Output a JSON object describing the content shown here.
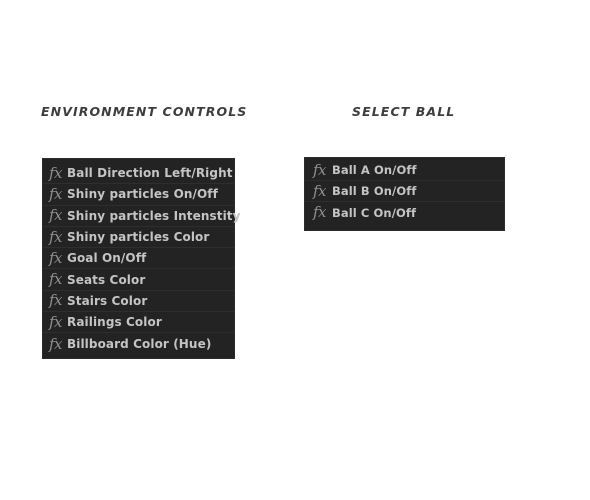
{
  "sections": {
    "environment": {
      "title": "ENVIRONMENT CONTROLS",
      "items": [
        {
          "icon": "fx-icon",
          "label": "Ball Direction Left/Right"
        },
        {
          "icon": "fx-icon",
          "label": "Shiny particles On/Off"
        },
        {
          "icon": "fx-icon",
          "label": "Shiny particles Intenstity"
        },
        {
          "icon": "fx-icon",
          "label": "Shiny particles Color"
        },
        {
          "icon": "fx-icon",
          "label": "Goal On/Off"
        },
        {
          "icon": "fx-icon",
          "label": "Seats Color"
        },
        {
          "icon": "fx-icon",
          "label": "Stairs Color"
        },
        {
          "icon": "fx-icon",
          "label": "Railings Color"
        },
        {
          "icon": "fx-icon",
          "label": "Billboard Color (Hue)"
        }
      ]
    },
    "select_ball": {
      "title": "SELECT BALL",
      "items": [
        {
          "icon": "fx-icon",
          "label": "Ball A On/Off"
        },
        {
          "icon": "fx-icon",
          "label": "Ball B On/Off"
        },
        {
          "icon": "fx-icon",
          "label": "Ball C On/Off"
        }
      ]
    }
  },
  "fx_glyph": "fx",
  "colors": {
    "panel_bg": "#232323",
    "text": "#c4c4c4",
    "fx_icon": "#8f8f8f",
    "heading": "#3d3d3d"
  }
}
